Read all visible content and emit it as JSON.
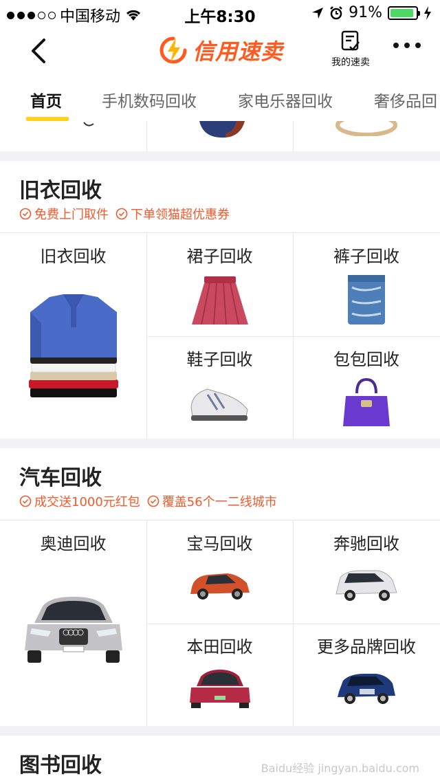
{
  "status_bar": {
    "carrier": "中国移动",
    "time": "上午8:30",
    "battery": "91%",
    "battery_level": 0.91
  },
  "nav": {
    "logo_text": "信用速卖",
    "my_orders": "我的速卖",
    "colors": {
      "brand": "#ff5a1f",
      "accent": "#ffd21f"
    }
  },
  "tabs": [
    {
      "label": "首页",
      "active": true
    },
    {
      "label": "手机数码回收",
      "active": false
    },
    {
      "label": "家电乐器回收",
      "active": false
    },
    {
      "label": "奢侈品回",
      "active": false
    }
  ],
  "sections": [
    {
      "title": "旧衣回收",
      "tags": [
        "免费上门取件",
        "下单领猫超优惠券"
      ],
      "main": {
        "label": "旧衣回收",
        "icon": "polo-shirt-stack"
      },
      "items": [
        {
          "label": "裙子回收",
          "icon": "skirt"
        },
        {
          "label": "裤子回收",
          "icon": "jeans"
        },
        {
          "label": "鞋子回收",
          "icon": "sneakers"
        },
        {
          "label": "包包回收",
          "icon": "handbag"
        }
      ]
    },
    {
      "title": "汽车回收",
      "tags": [
        "成交送1000元红包",
        "覆盖56个一二线城市"
      ],
      "main": {
        "label": "奥迪回收",
        "icon": "audi-car"
      },
      "items": [
        {
          "label": "宝马回收",
          "icon": "bmw-car"
        },
        {
          "label": "奔驰回收",
          "icon": "benz-suv"
        },
        {
          "label": "本田回收",
          "icon": "honda-car"
        },
        {
          "label": "更多品牌回收",
          "icon": "cadillac-car"
        }
      ]
    },
    {
      "title": "图书回收"
    }
  ],
  "watermark": "Baidu经验 jingyan.baidu.com"
}
